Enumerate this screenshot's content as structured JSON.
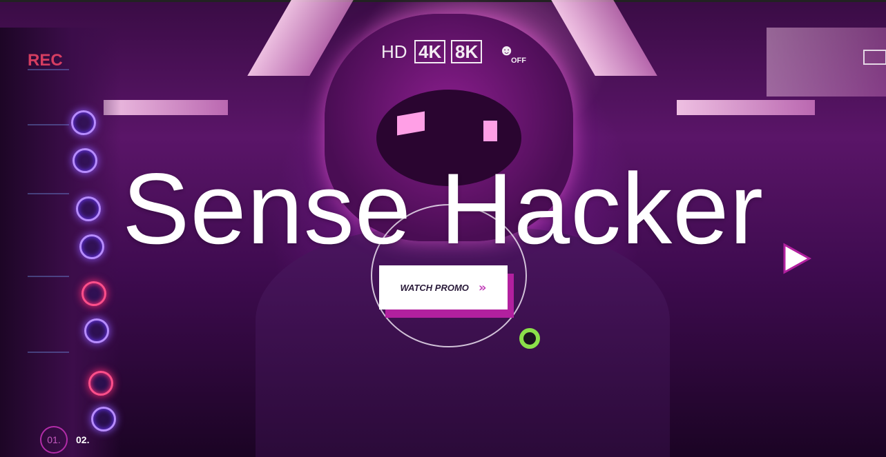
{
  "hero": {
    "title": "Sense Hacker",
    "cta_label": "WATCH PROMO",
    "cta_icon": "double-chevron-right-icon",
    "play_icon": "play-icon",
    "accent_color": "#b2209f",
    "text_color": "#ffffff"
  },
  "camera_overlay": {
    "rec": "REC",
    "hd": "HD",
    "res_4k": "4K",
    "res_8k": "8K",
    "off": "OFF"
  },
  "pagination": {
    "slides": [
      {
        "label": "01.",
        "active": true
      },
      {
        "label": "02.",
        "active": false
      }
    ]
  }
}
